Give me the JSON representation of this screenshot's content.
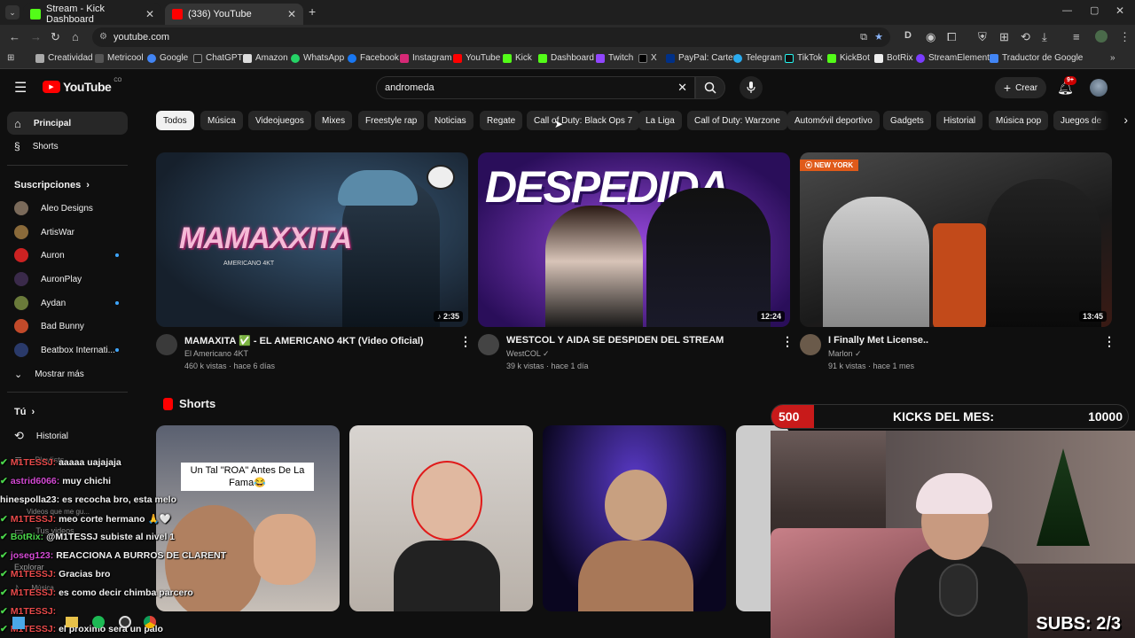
{
  "browser": {
    "tabs": [
      {
        "title": "Stream - Kick Dashboard"
      },
      {
        "title": "(336) YouTube"
      }
    ],
    "url": "youtube.com",
    "bookmarks": [
      "Creatividad",
      "Metricool",
      "Google",
      "ChatGPT",
      "Amazon",
      "WhatsApp",
      "Facebook",
      "Instagram",
      "YouTube",
      "Kick",
      "Dashboard",
      "Twitch",
      "X",
      "PayPal: Cartera",
      "Telegram",
      "TikTok",
      "KickBot",
      "BotRix",
      "StreamElements",
      "Traductor de Google"
    ]
  },
  "youtube": {
    "logo_text": "YouTube",
    "logo_country": "CO",
    "search_value": "andromeda",
    "create_label": "Crear",
    "notif_count": "9+",
    "chips": [
      "Todos",
      "Música",
      "Videojuegos",
      "Mixes",
      "Freestyle rap",
      "Noticias",
      "Regate",
      "Call of Duty: Black Ops 7",
      "La Liga",
      "Call of Duty: Warzone",
      "Automóvil deportivo",
      "Gadgets",
      "Historial",
      "Música pop",
      "Juegos de"
    ],
    "sidebar": {
      "main": [
        {
          "label": "Principal"
        },
        {
          "label": "Shorts"
        }
      ],
      "subs_title": "Suscripciones",
      "subs": [
        {
          "label": "Aleo Designs",
          "dot": false
        },
        {
          "label": "ArtisWar",
          "dot": false
        },
        {
          "label": "Auron",
          "dot": true
        },
        {
          "label": "AuronPlay",
          "dot": false
        },
        {
          "label": "Aydan",
          "dot": true
        },
        {
          "label": "Bad Bunny",
          "dot": false
        },
        {
          "label": "Beatbox Internati...",
          "dot": true
        }
      ],
      "show_more": "Mostrar más",
      "you_title": "Tú",
      "history": "Historial",
      "playlists": "Playlists",
      "your_videos": "Tus videos",
      "later": "Videos que me gu...",
      "explore": "Explorar",
      "music": "Música"
    },
    "videos": [
      {
        "title": "MAMAXITA ✅ - EL AMERICANO 4KT (Video Oficial)",
        "channel": "El Americano 4KT",
        "meta": "460 k vistas · hace 6 días",
        "duration": "2:35",
        "thumb_text": "MAMAXXITA",
        "thumb_sub": "AMERICANO 4KT"
      },
      {
        "title": "WESTCOL Y AIDA SE DESPIDEN DEL STREAM",
        "channel": "WestCOL",
        "meta": "39 k vistas · hace 1 día",
        "duration": "12:24",
        "thumb_text": "DESPEDIDA"
      },
      {
        "title": "I Finally Met License..",
        "channel": "Marlon",
        "meta": "91 k vistas · hace 1 mes",
        "duration": "13:45",
        "badge": "NEW YORK"
      }
    ],
    "shorts_title": "Shorts",
    "short1_caption": "Un Tal \"ROA\" Antes De La Fama😂"
  },
  "stream_overlay": {
    "kicks_left": "500",
    "kicks_label": "KICKS DEL MES:",
    "kicks_right": "10000",
    "subs": "SUBS: 2/3",
    "chat": [
      {
        "user": "M1TESSJ:",
        "msg": "aaaaa uajajaja",
        "color": "u"
      },
      {
        "user": "astrid6066:",
        "msg": "muy chichi",
        "color": "u2"
      },
      {
        "user": "hinespolla23:",
        "msg": "es recocha bro, esta melo",
        "color": "u3"
      },
      {
        "user": "M1TESSJ:",
        "msg": "meo corte hermano 🙏🤍",
        "color": "u"
      },
      {
        "user": "BotRix:",
        "msg": "@M1TESSJ subiste al nivel 1",
        "color": "u3"
      },
      {
        "user": "joseg123:",
        "msg": "REACCIONA A BURROS DE CLARENT",
        "color": "u2"
      },
      {
        "user": "M1TESSJ:",
        "msg": "Gracias bro",
        "color": "u"
      },
      {
        "user": "M1TESSJ:",
        "msg": "es como decir chimba parcero",
        "color": "u"
      },
      {
        "user": "M1TESSJ:",
        "msg": "",
        "color": "u"
      },
      {
        "user": "M1TESSJ:",
        "msg": "el proximo será un palo",
        "color": "u"
      }
    ]
  },
  "colors": {
    "yt_red": "#ff0000",
    "bg": "#0f0f0f",
    "kick_green": "#53fc18",
    "accent_blue": "#3ea6ff"
  }
}
